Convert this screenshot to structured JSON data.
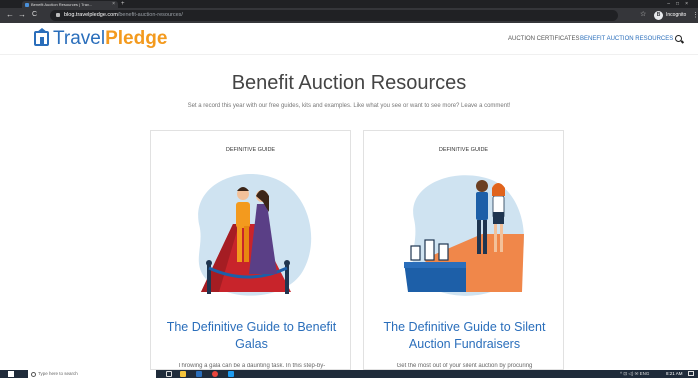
{
  "browser": {
    "tab_title": "Benefit Auction Resources | Trav...",
    "new_tab_glyph": "+",
    "back_icon": "←",
    "forward_icon": "→",
    "reload_icon": "C",
    "url_host": "blog.travelpledge.com",
    "url_path": "/benefit-auction-resources/",
    "bookmark_icon": "☆",
    "profile_initial": "B",
    "profile_name": "Incognito",
    "menu_icon": "⋮"
  },
  "site": {
    "logo_part1": "Travel",
    "logo_part2": "Pledge",
    "nav": [
      {
        "label": "AUCTION CERTIFICATES",
        "active": false
      },
      {
        "label": "BENEFIT AUCTION RESOURCES",
        "active": true
      }
    ]
  },
  "main": {
    "title": "Benefit Auction Resources",
    "subtitle": "Set a record this year with our free guides, kits and examples. Like what you see or want to see more? Leave a comment!",
    "cards": [
      {
        "kicker": "DEFINITIVE GUIDE",
        "title": "The Definitive Guide to Benefit Galas",
        "excerpt": "Throwing a gala can be a daunting task. In this step-by-"
      },
      {
        "kicker": "DEFINITIVE GUIDE",
        "title": "The Definitive Guide to Silent Auction Fundraisers",
        "excerpt": "Get the most out of your silent auction by procuring"
      }
    ]
  },
  "taskbar": {
    "search_placeholder": "Type here to search",
    "tray": "^ ⊡ ◁) ✉ ENG",
    "clock": "8:21 AM"
  },
  "colors": {
    "brand_blue": "#2a6ebb",
    "brand_orange": "#f39a1e",
    "carpet_red": "#c8242b",
    "table_blue": "#1d5fa8"
  }
}
